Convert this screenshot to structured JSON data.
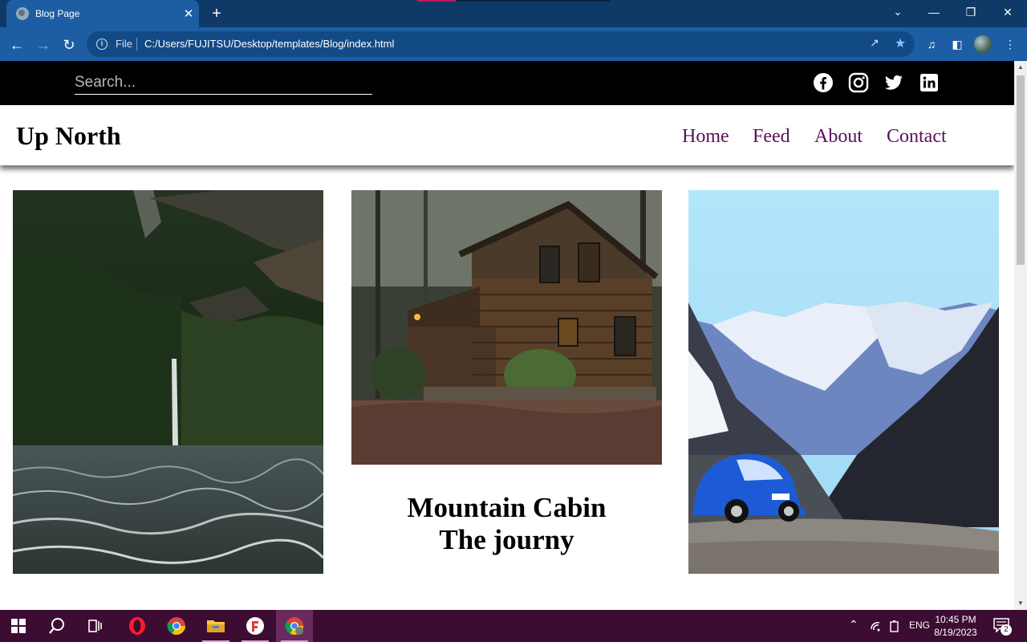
{
  "browser": {
    "tab_title": "Blog Page",
    "tab_close": "✕",
    "new_tab": "+",
    "address_label": "File",
    "url": "C:/Users/FUJITSU/Desktop/templates/Blog/index.html"
  },
  "site": {
    "search_placeholder": "Search...",
    "social": [
      "facebook-icon",
      "instagram-icon",
      "twitter-icon",
      "linkedin-icon"
    ],
    "brand": "Up North",
    "nav": [
      "Home",
      "Feed",
      "About",
      "Contact"
    ],
    "post_title_line1": "Mountain Cabin",
    "post_title_line2": "The journy"
  },
  "taskbar": {
    "language": "ENG",
    "time": "10:45 PM",
    "date": "8/19/2023",
    "notification_count": "2"
  },
  "colors": {
    "tabbar": "#0f3a68",
    "toolbar": "#1d5da3",
    "nav_link": "#5a0f5a",
    "taskbar": "#3d0c33"
  }
}
